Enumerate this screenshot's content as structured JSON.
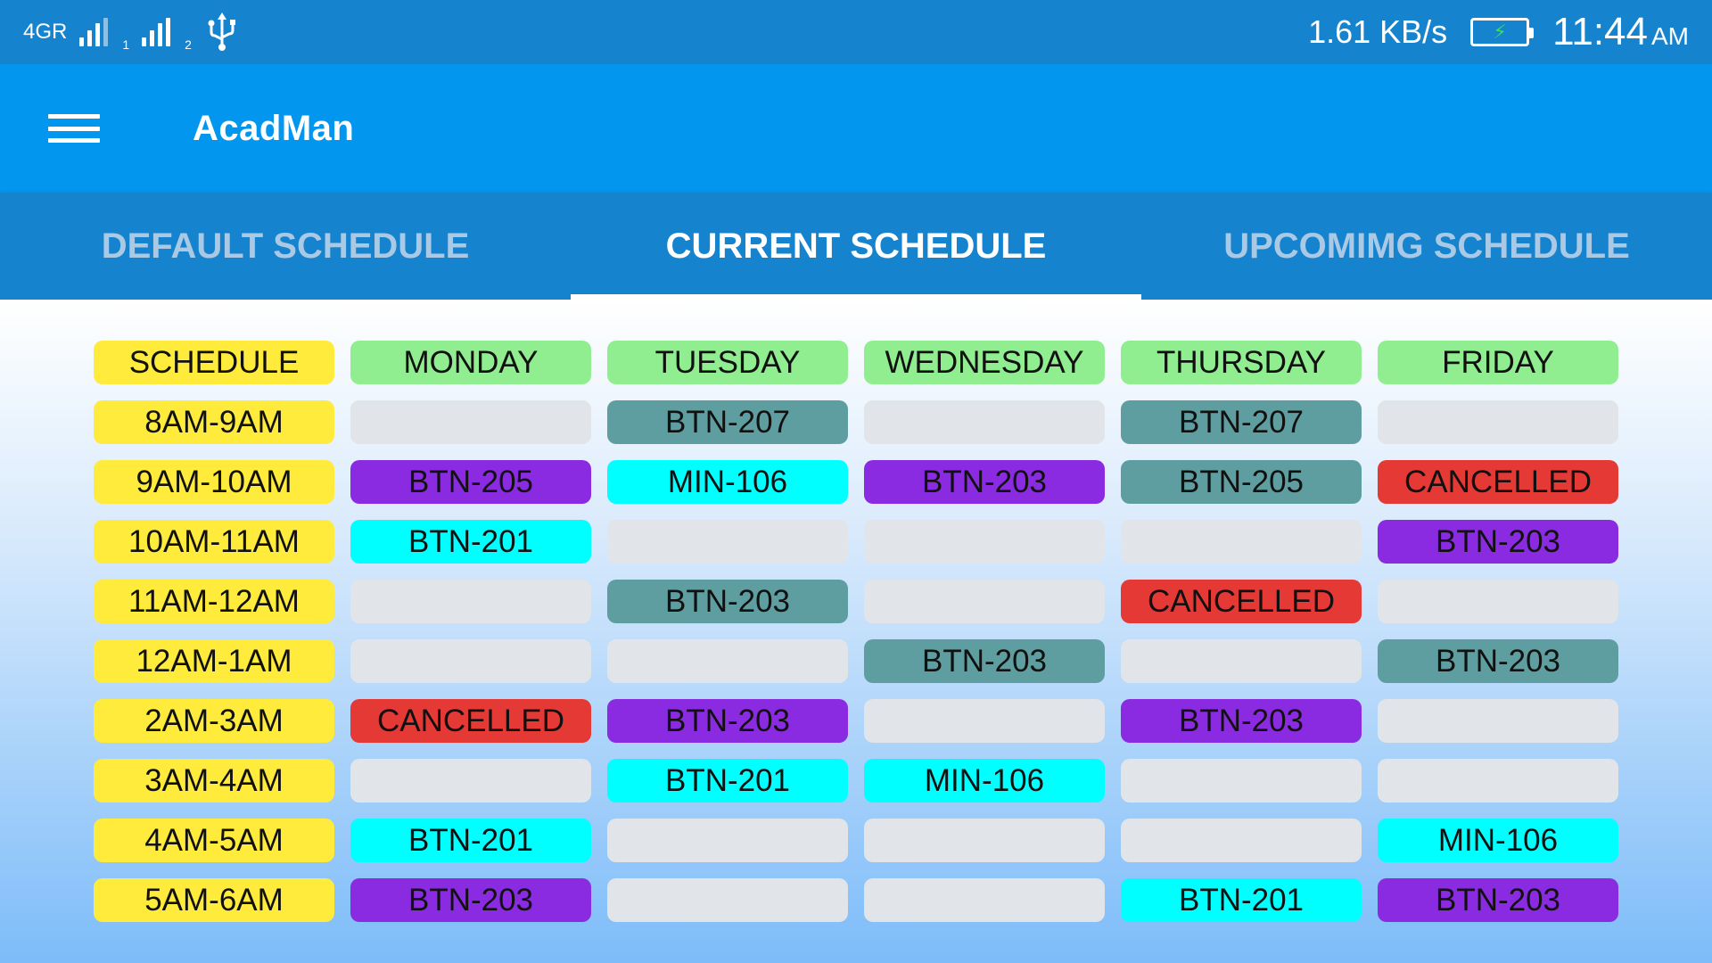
{
  "status_bar": {
    "network_type": "4G",
    "roaming": "R",
    "sim1_index": "1",
    "sim2_index": "2",
    "net_speed": "1.61 KB/s",
    "time": "11:44",
    "ampm": "AM",
    "icons": [
      "signal-icon",
      "usb-icon",
      "battery-charging-icon"
    ]
  },
  "app_bar": {
    "title": "AcadMan",
    "menu_icon": "hamburger-menu-icon"
  },
  "tabs": [
    {
      "label": "DEFAULT SCHEDULE",
      "active": false
    },
    {
      "label": "CURRENT SCHEDULE",
      "active": true
    },
    {
      "label": "UPCOMIMG SCHEDULE",
      "active": false
    }
  ],
  "colors": {
    "status_bar": "#1683cf",
    "app_bar": "#0396ee",
    "header_yellow": "#ffeb3b",
    "day_green": "#90ee90",
    "empty": "#e1e4e8",
    "teal": "#5f9ea0",
    "purple": "#8a2be2",
    "cyan": "#00ffff",
    "cancelled_red": "#e53935"
  },
  "schedule": {
    "corner_label": "SCHEDULE",
    "days": [
      "MONDAY",
      "TUESDAY",
      "WEDNESDAY",
      "THURSDAY",
      "FRIDAY"
    ],
    "rows": [
      {
        "time": "8AM-9AM",
        "slots": [
          {
            "text": "",
            "color": "empty"
          },
          {
            "text": "BTN-207",
            "color": "teal"
          },
          {
            "text": "",
            "color": "empty"
          },
          {
            "text": "BTN-207",
            "color": "teal"
          },
          {
            "text": "",
            "color": "empty"
          }
        ]
      },
      {
        "time": "9AM-10AM",
        "slots": [
          {
            "text": "BTN-205",
            "color": "purple"
          },
          {
            "text": "MIN-106",
            "color": "cyan"
          },
          {
            "text": "BTN-203",
            "color": "purple"
          },
          {
            "text": "BTN-205",
            "color": "teal"
          },
          {
            "text": "CANCELLED",
            "color": "red"
          }
        ]
      },
      {
        "time": "10AM-11AM",
        "slots": [
          {
            "text": "BTN-201",
            "color": "cyan"
          },
          {
            "text": "",
            "color": "empty"
          },
          {
            "text": "",
            "color": "empty"
          },
          {
            "text": "",
            "color": "empty"
          },
          {
            "text": "BTN-203",
            "color": "purple"
          }
        ]
      },
      {
        "time": "11AM-12AM",
        "slots": [
          {
            "text": "",
            "color": "empty"
          },
          {
            "text": "BTN-203",
            "color": "teal"
          },
          {
            "text": "",
            "color": "empty"
          },
          {
            "text": "CANCELLED",
            "color": "red"
          },
          {
            "text": "",
            "color": "empty"
          }
        ]
      },
      {
        "time": "12AM-1AM",
        "slots": [
          {
            "text": "",
            "color": "empty"
          },
          {
            "text": "",
            "color": "empty"
          },
          {
            "text": "BTN-203",
            "color": "teal"
          },
          {
            "text": "",
            "color": "empty"
          },
          {
            "text": "BTN-203",
            "color": "teal"
          }
        ]
      },
      {
        "time": "2AM-3AM",
        "slots": [
          {
            "text": "CANCELLED",
            "color": "red"
          },
          {
            "text": "BTN-203",
            "color": "purple"
          },
          {
            "text": "",
            "color": "empty"
          },
          {
            "text": "BTN-203",
            "color": "purple"
          },
          {
            "text": "",
            "color": "empty"
          }
        ]
      },
      {
        "time": "3AM-4AM",
        "slots": [
          {
            "text": "",
            "color": "empty"
          },
          {
            "text": "BTN-201",
            "color": "cyan"
          },
          {
            "text": "MIN-106",
            "color": "cyan"
          },
          {
            "text": "",
            "color": "empty"
          },
          {
            "text": "",
            "color": "empty"
          }
        ]
      },
      {
        "time": "4AM-5AM",
        "slots": [
          {
            "text": "BTN-201",
            "color": "cyan"
          },
          {
            "text": "",
            "color": "empty"
          },
          {
            "text": "",
            "color": "empty"
          },
          {
            "text": "",
            "color": "empty"
          },
          {
            "text": "MIN-106",
            "color": "cyan"
          }
        ]
      },
      {
        "time": "5AM-6AM",
        "slots": [
          {
            "text": "BTN-203",
            "color": "purple"
          },
          {
            "text": "",
            "color": "empty"
          },
          {
            "text": "",
            "color": "empty"
          },
          {
            "text": "BTN-201",
            "color": "cyan"
          },
          {
            "text": "BTN-203",
            "color": "purple"
          }
        ]
      }
    ]
  }
}
